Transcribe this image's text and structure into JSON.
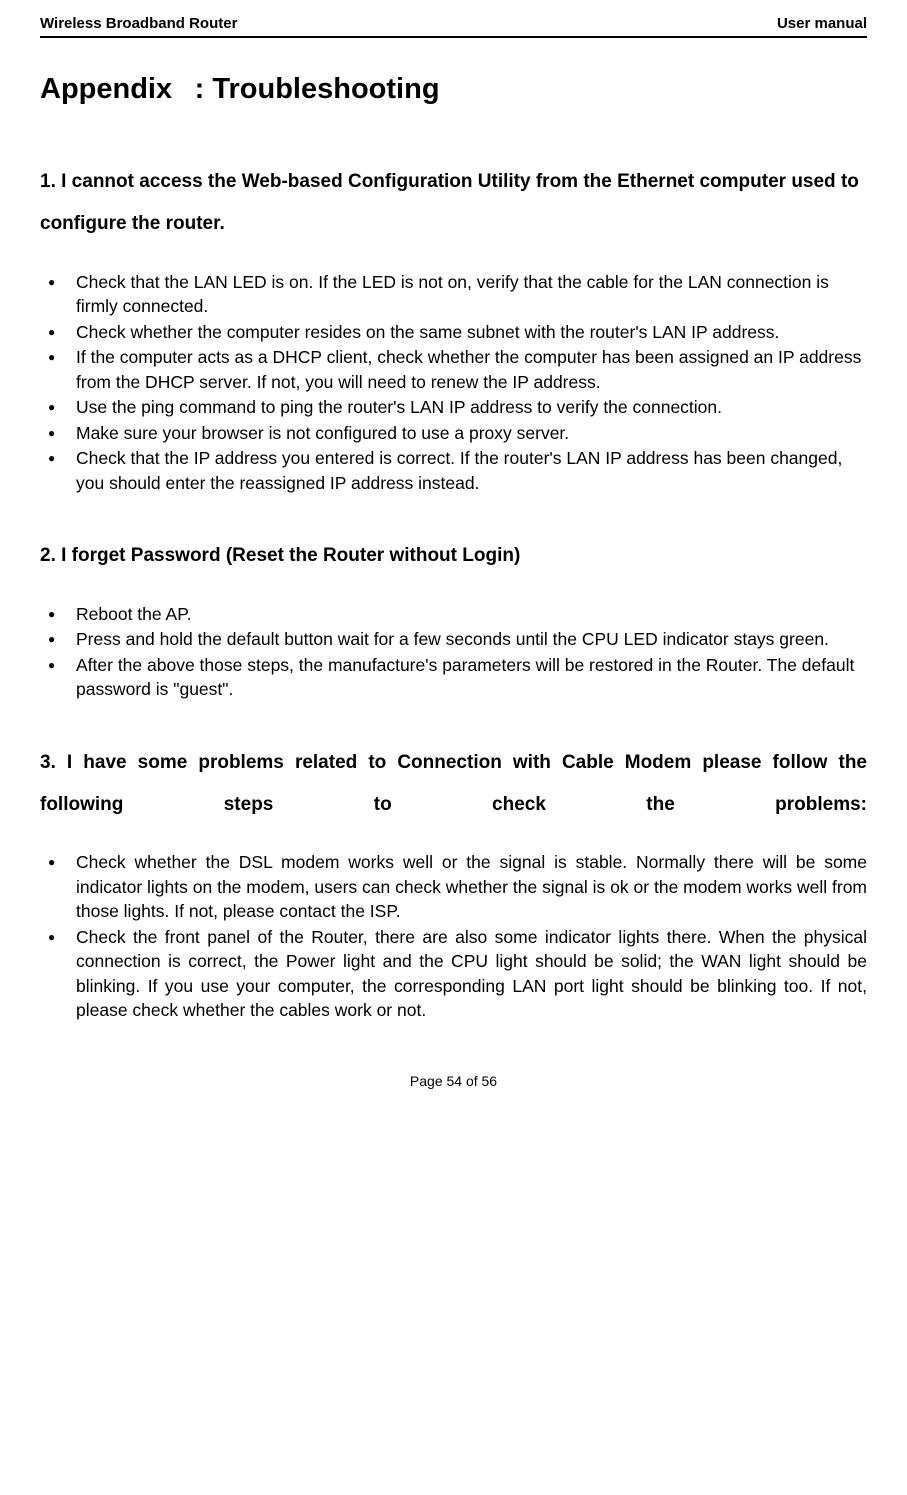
{
  "header": {
    "left": "Wireless Broadband Router",
    "right": "User manual"
  },
  "appendix_title": "Appendix  : Troubleshooting",
  "section1": {
    "heading": "1. I cannot access the Web-based Configuration Utility from the Ethernet computer used to configure the router.",
    "bullets": [
      "Check that the LAN LED is on. If the LED is not on, verify that the cable for the LAN connection is firmly connected.",
      "Check whether the computer resides on the same subnet with the router's LAN IP address.",
      "If the computer acts as a DHCP client, check whether the computer has been assigned an IP address from the DHCP server. If not, you will need to renew the IP address.",
      "Use the ping command to ping the router's LAN IP address to verify the connection.",
      "Make sure your browser is not configured to use a proxy server.",
      "Check that the IP address you entered is correct. If the router's LAN IP address has been changed, you should enter the reassigned IP address instead."
    ]
  },
  "section2": {
    "heading": "2. I forget Password (Reset the Router without Login)",
    "bullets": [
      "Reboot the AP.",
      "Press and hold the default button wait for a few seconds until the CPU LED indicator stays green.",
      "After the above those steps, the manufacture's parameters will be restored in the Router. The default password is \"guest\"."
    ]
  },
  "section3": {
    "heading": "3. I have some problems related to Connection with Cable Modem please follow the following steps to check the problems:",
    "bullets": [
      "Check whether the DSL modem works well or the signal is stable. Normally there will be some indicator lights on the modem, users can check whether the signal is ok or the modem works well from those lights. If not, please contact the ISP.",
      "Check the front panel of the Router, there are also some indicator lights there. When the physical connection is correct, the Power light and the CPU light should be solid; the WAN light should be blinking. If you use your computer, the corresponding LAN port light should be blinking too. If not, please check whether the cables work or not."
    ]
  },
  "footer": "Page 54 of 56"
}
